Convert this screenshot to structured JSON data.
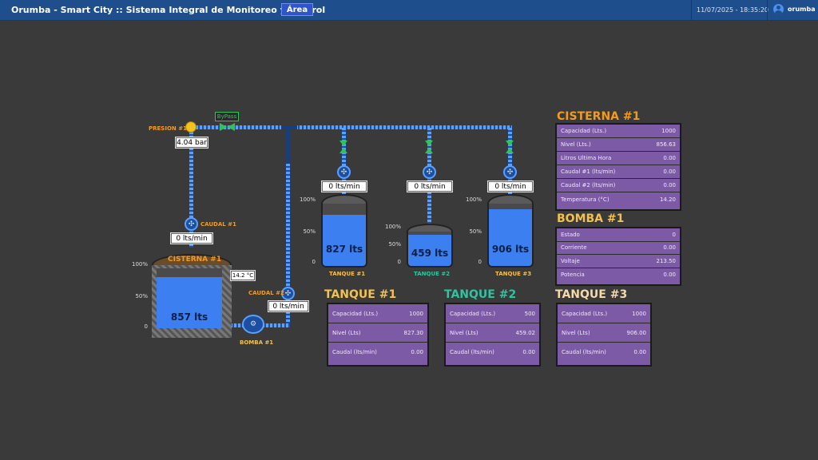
{
  "header": {
    "title": "Orumba - Smart City :: Sistema Integral de Monitoreo y Control",
    "area_button": "Área",
    "datetime": "11/07/2025 - 18:35:20",
    "user": "orumba"
  },
  "diagram": {
    "presion_label": "PRESION #1",
    "presion_value": "4.04 bar",
    "bypass": "ByPass",
    "caudal1_label": "CAUDAL #1",
    "caudal1_value": "0  lts/min",
    "caudal2_label": "CAUDAL #2",
    "caudal2_value": "0 lts/min",
    "bomba_label": "BOMBA #1",
    "cisterna": {
      "title": "CISTERNA #1",
      "level": "857 lts",
      "temp": "14.2 °C",
      "fill": 0.857,
      "p100": "100%",
      "p50": "50%",
      "p0": "0"
    },
    "tanques": [
      {
        "name": "TANQUE #1",
        "flow": "0 lts/min",
        "level": "827 lts",
        "fill": 0.827,
        "p100": "100%",
        "p50": "50%",
        "p0": "0"
      },
      {
        "name": "TANQUE #2",
        "flow": "0 lts/min",
        "level": "459 lts",
        "fill": 0.918,
        "p100": "100%",
        "p50": "50%",
        "p0": "0"
      },
      {
        "name": "TANQUE #3",
        "flow": "0 lts/min",
        "level": "906 lts",
        "fill": 0.906,
        "p100": "100%",
        "p50": "50%",
        "p0": "0"
      }
    ]
  },
  "panels": {
    "cisterna": {
      "title": "CISTERNA #1",
      "rows": [
        {
          "k": "Capacidad (Lts.)",
          "v": "1000"
        },
        {
          "k": "Nivel (Lts.)",
          "v": "856.63"
        },
        {
          "k": "Litros Ultima Hora",
          "v": "0.00"
        },
        {
          "k": "Caudal #1 (lts/min)",
          "v": "0.00"
        },
        {
          "k": "Caudal #2 (lts/min)",
          "v": "0.00"
        },
        {
          "k": "Temperatura (°C)",
          "v": "14.20"
        }
      ]
    },
    "bomba": {
      "title": "BOMBA #1",
      "rows": [
        {
          "k": "Estado",
          "v": "0"
        },
        {
          "k": "Corriente",
          "v": "0.00"
        },
        {
          "k": "Voltaje",
          "v": "213.50"
        },
        {
          "k": "Potencia",
          "v": "0.00"
        }
      ]
    },
    "tanque1": {
      "title": "TANQUE #1",
      "rows": [
        {
          "k": "Capacidad (Lts.)",
          "v": "1000"
        },
        {
          "k": "Nivel (Lts)",
          "v": "827.30"
        },
        {
          "k": "Caudal (lts/min)",
          "v": "0.00"
        }
      ]
    },
    "tanque2": {
      "title": "TANQUE #2",
      "rows": [
        {
          "k": "Capacidad (Lts.)",
          "v": "500"
        },
        {
          "k": "Nivel (Lts)",
          "v": "459.02"
        },
        {
          "k": "Caudal (lts/min)",
          "v": "0.00"
        }
      ]
    },
    "tanque3": {
      "title": "TANQUE #3",
      "rows": [
        {
          "k": "Capacidad (Lts.)",
          "v": "1000"
        },
        {
          "k": "Nivel (Lts)",
          "v": "906.00"
        },
        {
          "k": "Caudal (lts/min)",
          "v": "0.00"
        }
      ]
    }
  },
  "colors": {
    "accent": "#1f4e8c",
    "cisterna_title": "#f39b1c",
    "bomba_title": "#f2c14e",
    "tanque1_title": "#f2c14e",
    "tanque2_title": "#2ec4a0",
    "tanque3_title": "#f5d9a8",
    "water": "#3b7ff0",
    "panel": "#7c5aa5"
  }
}
